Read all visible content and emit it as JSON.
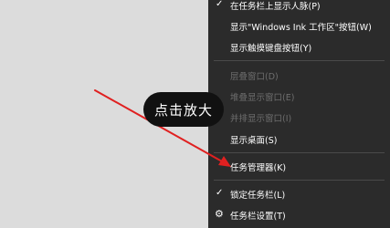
{
  "context_menu": {
    "items": [
      {
        "label": "在任务栏上显示人脉(P)",
        "checked": true,
        "enabled": true
      },
      {
        "label": "显示\"Windows Ink 工作区\"按钮(W)",
        "enabled": true
      },
      {
        "label": "显示触摸键盘按钮(Y)",
        "enabled": true
      },
      {
        "label": "层叠窗口(D)",
        "enabled": false
      },
      {
        "label": "堆叠显示窗口(E)",
        "enabled": false
      },
      {
        "label": "并排显示窗口(I)",
        "enabled": false
      },
      {
        "label": "显示桌面(S)",
        "enabled": true
      },
      {
        "label": "任务管理器(K)",
        "enabled": true
      },
      {
        "label": "锁定任务栏(L)",
        "checked": true,
        "enabled": true
      },
      {
        "label": "任务栏设置(T)",
        "enabled": true,
        "icon": "gear-icon"
      }
    ]
  },
  "overlay": {
    "zoom_label": "点击放大",
    "arrow_color": "#e02020"
  },
  "colors": {
    "menu_bg": "#2b2b2b",
    "menu_text": "#ffffff",
    "menu_disabled_text": "#6e6e6e",
    "desktop_bg": "#dcdcdc"
  }
}
